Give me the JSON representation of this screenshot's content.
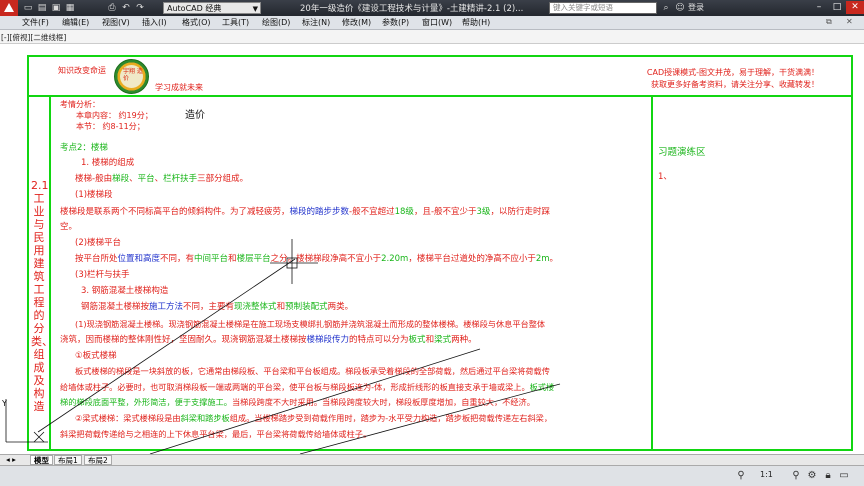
{
  "titlebar": {
    "workspace": "AutoCAD 经典",
    "doc_title": "20年一级造价《建设工程技术与计量》-土建精讲-2.1 (2)...",
    "search_placeholder": "键入关键字或短语",
    "login": "登录"
  },
  "menu": [
    "文件(F)",
    "编辑(E)",
    "视图(V)",
    "插入(I)",
    "格式(O)",
    "工具(T)",
    "绘图(D)",
    "标注(N)",
    "修改(M)",
    "参数(P)",
    "窗口(W)",
    "帮助(H)"
  ],
  "viewport_controls": "[-][俯视][二维线框]",
  "header": {
    "left_text": "知识改变命运",
    "slogan": "学习成就未来",
    "seal_text": "宇翔 造价",
    "right_line1": "CAD授课模式-图文并茂，易于理解，干货满满！",
    "right_line2": "获取更多好备考资料，请关注分享、收藏转发！"
  },
  "side_title": "2.1工业与民用建筑工程的分类、组成及构造",
  "practice": {
    "title": "习题演练区",
    "item1": "1、"
  },
  "content": {
    "analysis": "考情分析：",
    "importance": "本章内容：    约19分；",
    "section": "本节：      约8-11分；",
    "subject": "造价",
    "point2": "考点2：楼梯",
    "h1": "1. 楼梯的组成",
    "l1_a": "楼梯-般由",
    "l1_b": "梯段",
    "l1_c": "、",
    "l1_d": "平台",
    "l1_e": "、",
    "l1_f": "栏杆扶手",
    "l1_g": "三部分组成。",
    "h_ladder": "(1)楼梯段",
    "l2_a": "楼梯段是联系两个不同标高平台的倾斜构件。为了减轻疲劳，",
    "l2_b": "梯段的踏步步数",
    "l2_c": "-般不宜超过",
    "l2_d": "18级",
    "l2_e": "，且-般不宜少于",
    "l2_f": "3级",
    "l2_g": "，以防行走时踩",
    "l2_h": "空。",
    "h_platform": "(2)楼梯平台",
    "l3_a": "按平台所处",
    "l3_b": "位置和高度",
    "l3_c": "不同，有",
    "l3_d": "中间平台",
    "l3_e": "和",
    "l3_f": "楼层平台",
    "l3_g": "之分。楼梯梯段净高不宜小于",
    "l3_h": "2.20m",
    "l3_i": "，楼梯平台过道处的净高不应小于",
    "l3_j": "2m",
    "l3_k": "。",
    "h_rail": "(3)栏杆与扶手",
    "h_concrete": "3. 钢筋混凝土楼梯构造",
    "l4_a": "钢筋混凝土楼梯按",
    "l4_b": "施工方法",
    "l4_c": "不同，主要有",
    "l4_d": "现浇整体式",
    "l4_e": "和",
    "l4_f": "预制装配式",
    "l4_g": "两类。",
    "l5": "(1)现浇钢筋混凝土楼梯。现浇钢筋混凝土楼梯是在施工现场支模绑扎钢筋并浇筑混凝土而形成的整体楼梯。楼梯段与休息平台整体",
    "l6_a": "浇筑，因而楼梯的整体刚性好，坚固耐久。现浇钢筋混凝土楼梯按",
    "l6_b": "楼梯段传力",
    "l6_c": "的特点可以分为",
    "l6_d": "板式",
    "l6_e": "和",
    "l6_f": "梁式",
    "l6_g": "两种。",
    "h_slab": "①板式楼梯",
    "l7": "板式楼梯的梯段是一块斜放的板，它通常由梯段板、平台梁和平台板组成。梯段板承受着梯段的全部荷载，然后通过平台梁将荷载传",
    "l8_a": "给墙体或柱子。必要时，也可取消梯段板一端或两端的平台梁，使平台板与梯段板连为-体，形成折线形的板直接支承于墙或梁上。",
    "l8_b": "板式楼",
    "l9_a": "梯的梯段底面平整，外形简洁，便于支撑施工。",
    "l9_b": "当梯段跨度不大时采用。当梯段跨度较大时，梯段板厚度增加，自重较大，不经济。",
    "l10_a": "②梁式楼梯：梁式楼梯段是由",
    "l10_b": "斜梁和踏步板",
    "l10_c": "组成。当楼梯踏步受到荷载作用时，踏步为-水平受力构造，踏步板把荷载传递左右斜梁，",
    "l11": "斜梁把荷载传递给与之相连的上下休息平台梁，最后，平台梁将荷载传给墙体或柱子。"
  },
  "layout_tabs": [
    "模型",
    "布局1",
    "布局2"
  ],
  "status": {
    "scale": "1:1"
  },
  "colors": {
    "frame": "#11d611",
    "red_text": "#e0221c",
    "green_text": "#19b519",
    "blue_text": "#2233cc"
  }
}
